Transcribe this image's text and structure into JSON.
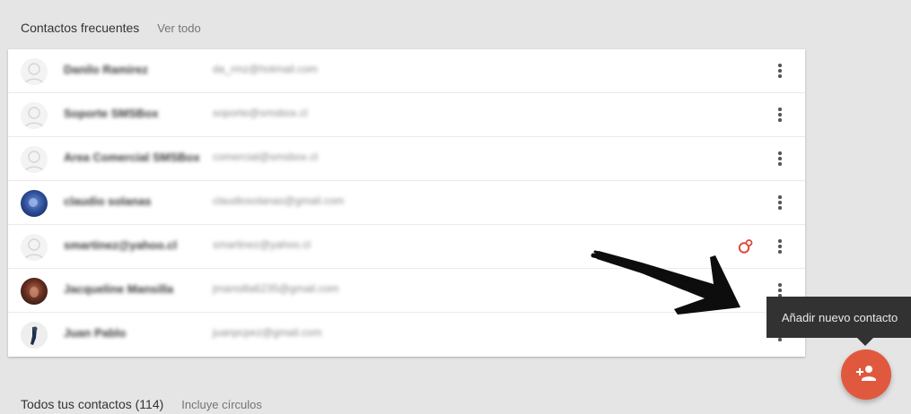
{
  "frequent": {
    "title": "Contactos frecuentes",
    "view_all": "Ver todo"
  },
  "contacts": [
    {
      "name": "Danilo Ramirez",
      "email": "da_rmz@hotmail.com",
      "avatar": "default"
    },
    {
      "name": "Soporte SMSBox",
      "email": "soporte@smsbox.cl",
      "avatar": "default"
    },
    {
      "name": "Area Comercial SMSBox",
      "email": "comercial@smsbox.cl",
      "avatar": "default"
    },
    {
      "name": "claudio solanas",
      "email": "claudiosolanas@gmail.com",
      "avatar": "photo-blue"
    },
    {
      "name": "smartinez@yahoo.cl",
      "email": "smartinez@yahoo.cl",
      "avatar": "default"
    },
    {
      "name": "Jacqueline Mansilla",
      "email": "jmansilla6235@gmail.com",
      "avatar": "photo-brown"
    },
    {
      "name": "Juan Pablo",
      "email": "juanpcpez@gmail.com",
      "avatar": "photo-dark"
    }
  ],
  "icons": {
    "more": "more-vert-icon",
    "gplus": "google-plus-circles-icon",
    "fab": "person-add-icon"
  },
  "tooltip": {
    "text": "Añadir nuevo contacto"
  },
  "all_contacts": {
    "title": "Todos tus contactos (114)",
    "subtitle": "Incluye círculos"
  },
  "colors": {
    "fab": "#e0593f",
    "tooltip_bg": "#323232",
    "gplus": "#dd4b39",
    "background": "#e5e5e5"
  }
}
